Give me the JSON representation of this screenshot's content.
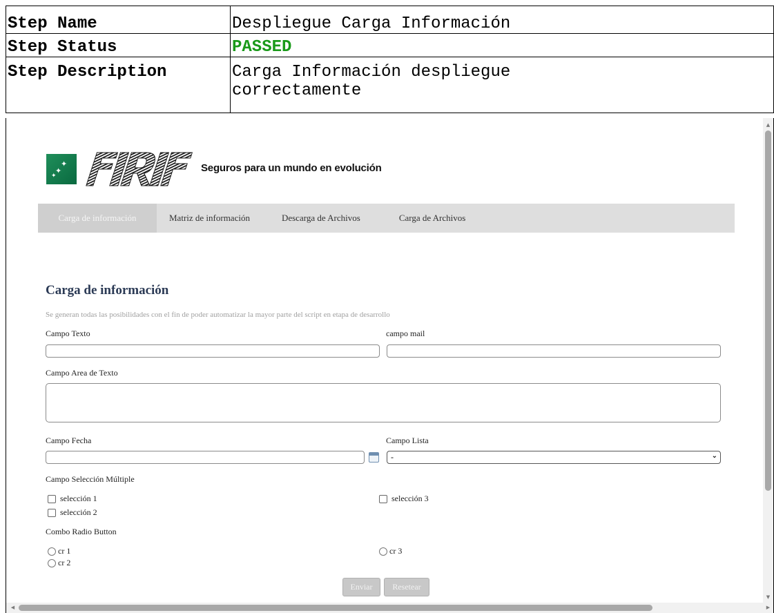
{
  "report": {
    "rows": [
      {
        "key": "Step Name",
        "value": "Despliegue Carga Información"
      },
      {
        "key": "Step Status",
        "value": "PASSED"
      },
      {
        "key": "Step Description",
        "value_line1": "Carga Información despliegue",
        "value_line2": "correctamente"
      }
    ],
    "status_color": "#1a9a1a"
  },
  "app": {
    "tagline": "Seguros para un mundo en evolución",
    "logo_icon": "bnp-stars-logo"
  },
  "nav": {
    "items": [
      {
        "label": "Carga de información",
        "active": true
      },
      {
        "label": "Matriz de información",
        "active": false
      },
      {
        "label": "Descarga de Archivos",
        "active": false
      },
      {
        "label": "Carga de Archivos",
        "active": false
      }
    ]
  },
  "form": {
    "title": "Carga de información",
    "description": "Se generan todas las posibilidades con el fin de poder automatizar la mayor parte del script en etapa de desarrollo",
    "campo_texto": {
      "label": "Campo Texto",
      "value": ""
    },
    "campo_mail": {
      "label": "campo mail",
      "value": ""
    },
    "campo_area": {
      "label": "Campo Area de Texto",
      "value": ""
    },
    "campo_fecha": {
      "label": "Campo Fecha",
      "value": ""
    },
    "campo_lista": {
      "label": "Campo Lista",
      "selected": "-"
    },
    "multi": {
      "label": "Campo Selección Múltiple",
      "options": [
        "selección 1",
        "selección 2",
        "selección 3"
      ]
    },
    "radio": {
      "label": "Combo Radio Button",
      "options": [
        "cr 1",
        "cr 2",
        "cr 3"
      ]
    },
    "submit_label": "Enviar",
    "reset_label": "Resetear"
  }
}
